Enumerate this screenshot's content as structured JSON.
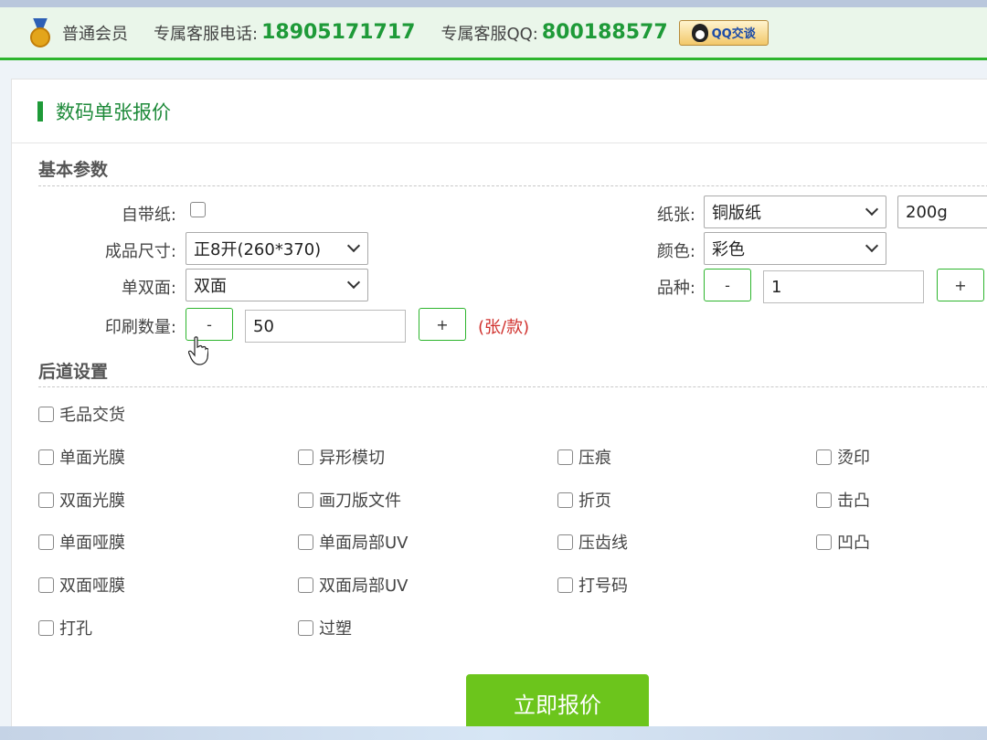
{
  "header": {
    "member_level": "普通会员",
    "phone_label": "专属客服电话:",
    "phone_number": "18905171717",
    "qq_label": "专属客服QQ:",
    "qq_number": "800188577",
    "qq_button": "QQ交谈"
  },
  "card": {
    "title": "数码单张报价"
  },
  "basic": {
    "section_title": "基本参数",
    "own_paper_label": "自带纸:",
    "size_label": "成品尺寸:",
    "size_value": "正8开(260*370)",
    "sides_label": "单双面:",
    "sides_value": "双面",
    "quantity_label": "印刷数量:",
    "quantity_minus": "-",
    "quantity_value": "50",
    "quantity_plus": "+",
    "quantity_unit": "(张/款)",
    "paper_label": "纸张:",
    "paper_value": "铜版纸",
    "weight_value": "200g",
    "color_label": "颜色:",
    "color_value": "彩色",
    "variety_label": "品种:",
    "variety_minus": "-",
    "variety_value": "1",
    "variety_plus": "+"
  },
  "finishing": {
    "section_title": "后道设置",
    "options": [
      "毛品交货",
      "单面光膜",
      "异形模切",
      "压痕",
      "烫印",
      "双面光膜",
      "画刀版文件",
      "折页",
      "击凸",
      "单面哑膜",
      "单面局部UV",
      "压齿线",
      "凹凸",
      "双面哑膜",
      "双面局部UV",
      "打号码",
      "打孔",
      "过塑"
    ]
  },
  "submit_label": "立即报价"
}
